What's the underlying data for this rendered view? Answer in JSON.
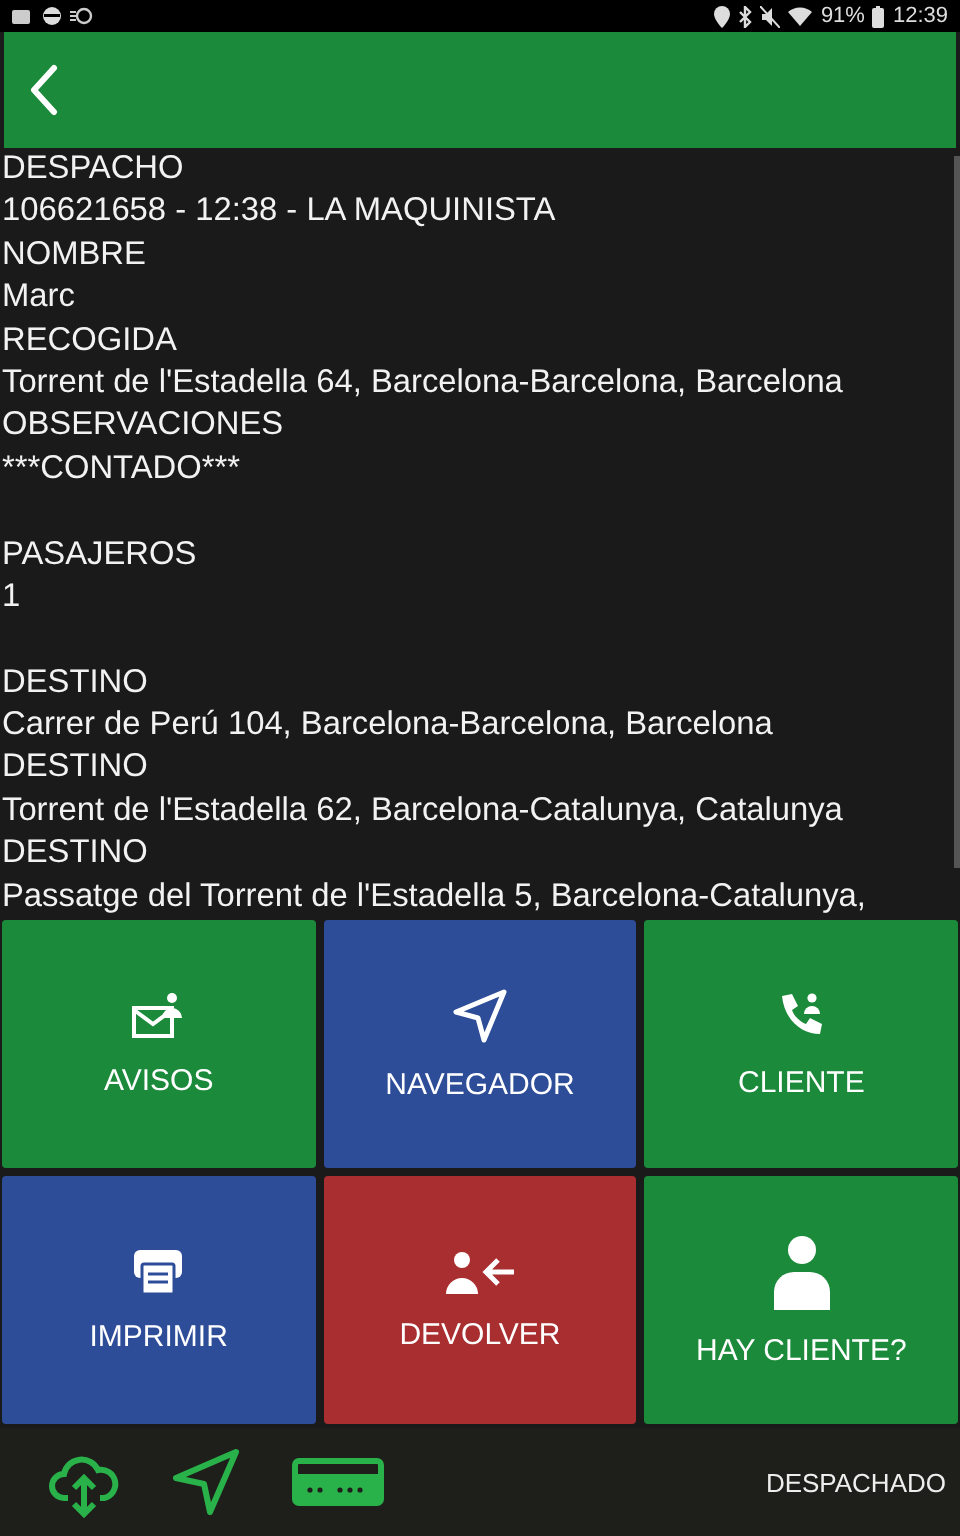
{
  "status_bar": {
    "battery": "91%",
    "time": "12:39"
  },
  "details": [
    {
      "label": "DESPACHO",
      "value": "106621658 - 12:38 - LA MAQUINISTA",
      "blank_after": false
    },
    {
      "label": "NOMBRE",
      "value": "Marc",
      "blank_after": false
    },
    {
      "label": "RECOGIDA",
      "value": "Torrent de l'Estadella 64, Barcelona-Barcelona, Barcelona",
      "blank_after": false
    },
    {
      "label": "OBSERVACIONES",
      "value": "***CONTADO***",
      "blank_after": true
    },
    {
      "label": "PASAJEROS",
      "value": "1",
      "blank_after": true
    },
    {
      "label": "DESTINO",
      "value": "Carrer de Perú 104, Barcelona-Barcelona, Barcelona",
      "blank_after": false
    },
    {
      "label": "DESTINO",
      "value": "Torrent de l'Estadella 62, Barcelona-Catalunya, Catalunya",
      "blank_after": false
    },
    {
      "label": "DESTINO",
      "value": "Passatge del Torrent de l'Estadella 5, Barcelona-Catalunya,",
      "blank_after": false
    }
  ],
  "actions": [
    {
      "label": "AVISOS",
      "kind": "mail",
      "color": "#1b8a3a"
    },
    {
      "label": "NAVEGADOR",
      "kind": "nav",
      "color": "#2e4d98"
    },
    {
      "label": "CLIENTE",
      "kind": "phone",
      "color": "#1b8a3a"
    },
    {
      "label": "IMPRIMIR",
      "kind": "print",
      "color": "#2e4d98"
    },
    {
      "label": "DEVOLVER",
      "kind": "return",
      "color": "#a82e30"
    },
    {
      "label": "HAY CLIENTE?",
      "kind": "person",
      "color": "#1b8a3a"
    }
  ],
  "footer": {
    "status": "DESPACHADO"
  }
}
